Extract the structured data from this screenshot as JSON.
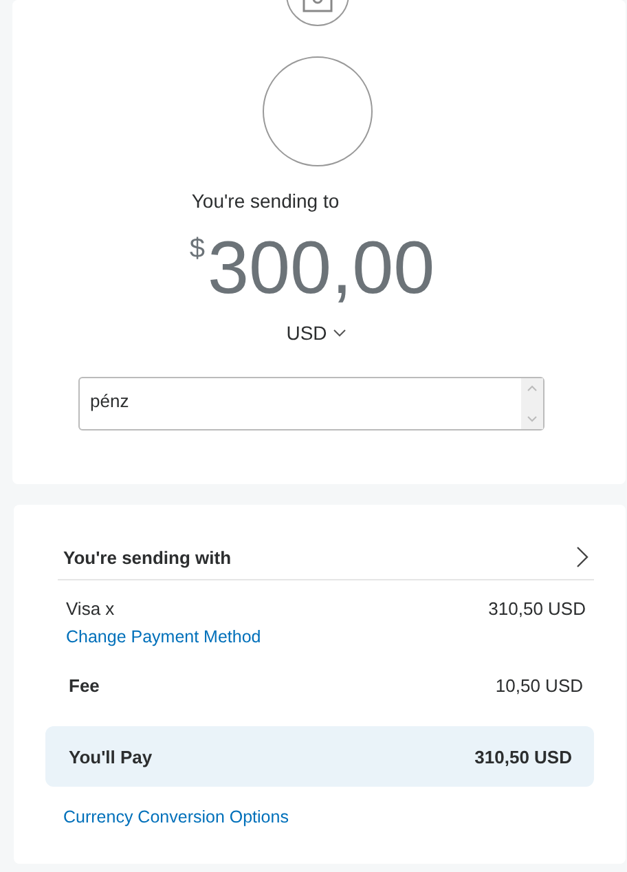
{
  "recipient": {
    "label": "You're sending to"
  },
  "amount": {
    "symbol": "$",
    "value": "300,00",
    "currency": "USD"
  },
  "note": {
    "value": "pénz"
  },
  "payment": {
    "title": "You're sending with",
    "method": {
      "name": "Visa x",
      "amount": "310,50 USD",
      "link": "Change Payment Method"
    },
    "fee": {
      "label": "Fee",
      "amount": "10,50 USD"
    },
    "total": {
      "label": "You'll Pay",
      "amount": "310,50 USD"
    },
    "conversion_link": "Currency Conversion Options"
  }
}
